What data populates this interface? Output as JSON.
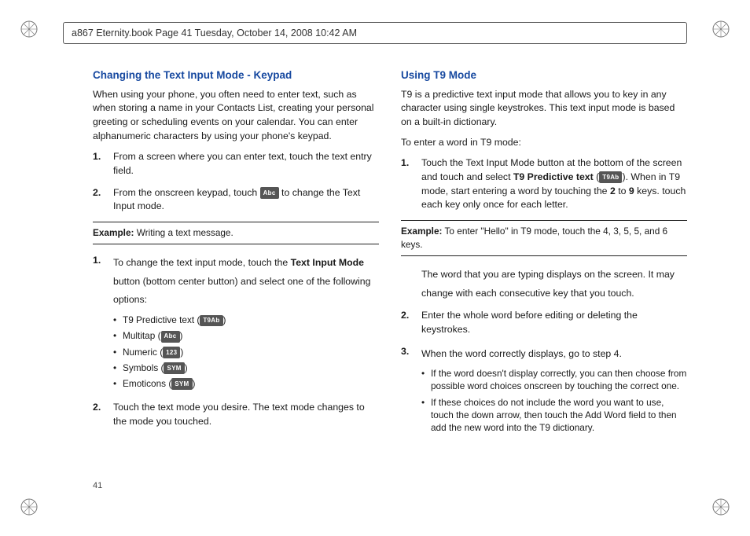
{
  "header": {
    "text": "a867 Eternity.book  Page 41  Tuesday, October 14, 2008  10:42 AM"
  },
  "page_number": "41",
  "left": {
    "heading": "Changing the Text Input Mode - Keypad",
    "intro": "When using your phone, you often need to enter text, such as when storing a name in your Contacts List, creating your personal greeting or scheduling events on your calendar. You can enter alphanumeric characters by using your phone's keypad.",
    "steps1": [
      {
        "num": "1.",
        "text": "From a screen where you can enter text, touch the text entry field."
      },
      {
        "num": "2.",
        "pre": "From the onscreen keypad, touch ",
        "key": "Abc",
        "post": " to change the Text Input mode."
      }
    ],
    "example": {
      "label": "Example:",
      "text": " Writing a text message."
    },
    "steps2": [
      {
        "num": "1.",
        "pre": "To change the text input mode, touch the ",
        "bold": "Text Input Mode",
        "post": " button (bottom center button) and select one of the following options:",
        "options": [
          {
            "label": "T9 Predictive text (",
            "key": "T9Ab",
            "close": ")"
          },
          {
            "label": "Multitap (",
            "key": "Abc",
            "close": ")"
          },
          {
            "label": "Numeric (",
            "key": "123",
            "close": ")"
          },
          {
            "label": "Symbols (",
            "key": "SYM",
            "close": ")"
          },
          {
            "label": "Emoticons (",
            "key": "SYM",
            "close": ")"
          }
        ]
      },
      {
        "num": "2.",
        "text": "Touch the text mode you desire. The text mode changes to the mode you touched."
      }
    ]
  },
  "right": {
    "heading": "Using T9 Mode",
    "intro1": "T9 is a predictive text input mode that allows you to key in any character using single keystrokes. This text input mode is based on a built-in dictionary.",
    "intro2": "To enter a word in T9 mode:",
    "step1": {
      "num": "1.",
      "pre": "Touch the Text Input Mode button at the bottom of the screen and touch and select ",
      "bold": "T9 Predictive text",
      "open": " (",
      "key": "T9Ab",
      "close": "). ",
      "line2a": "When in T9 mode, start entering a word by touching the ",
      "bold2": "2",
      "line2b": " to ",
      "bold3": "9",
      "line2c": " keys. touch each key only once for each letter."
    },
    "example": {
      "label": "Example:",
      "text": " To enter \"Hello\" in T9 mode, touch the 4, 3, 5, 5, and 6 keys."
    },
    "after_example": "The word that you are typing displays on the screen. It may change with each consecutive key that you touch.",
    "step2": {
      "num": "2.",
      "text": "Enter the whole word before editing or deleting the keystrokes."
    },
    "step3": {
      "num": "3.",
      "text": "When the word correctly displays, go to step 4.",
      "sub": [
        "If the word doesn't display correctly, you can then choose from possible word choices onscreen by touching the correct one.",
        "If these choices do not include the word you want to use, touch the down arrow, then touch the Add Word field to then add the new word into the T9 dictionary."
      ]
    }
  }
}
